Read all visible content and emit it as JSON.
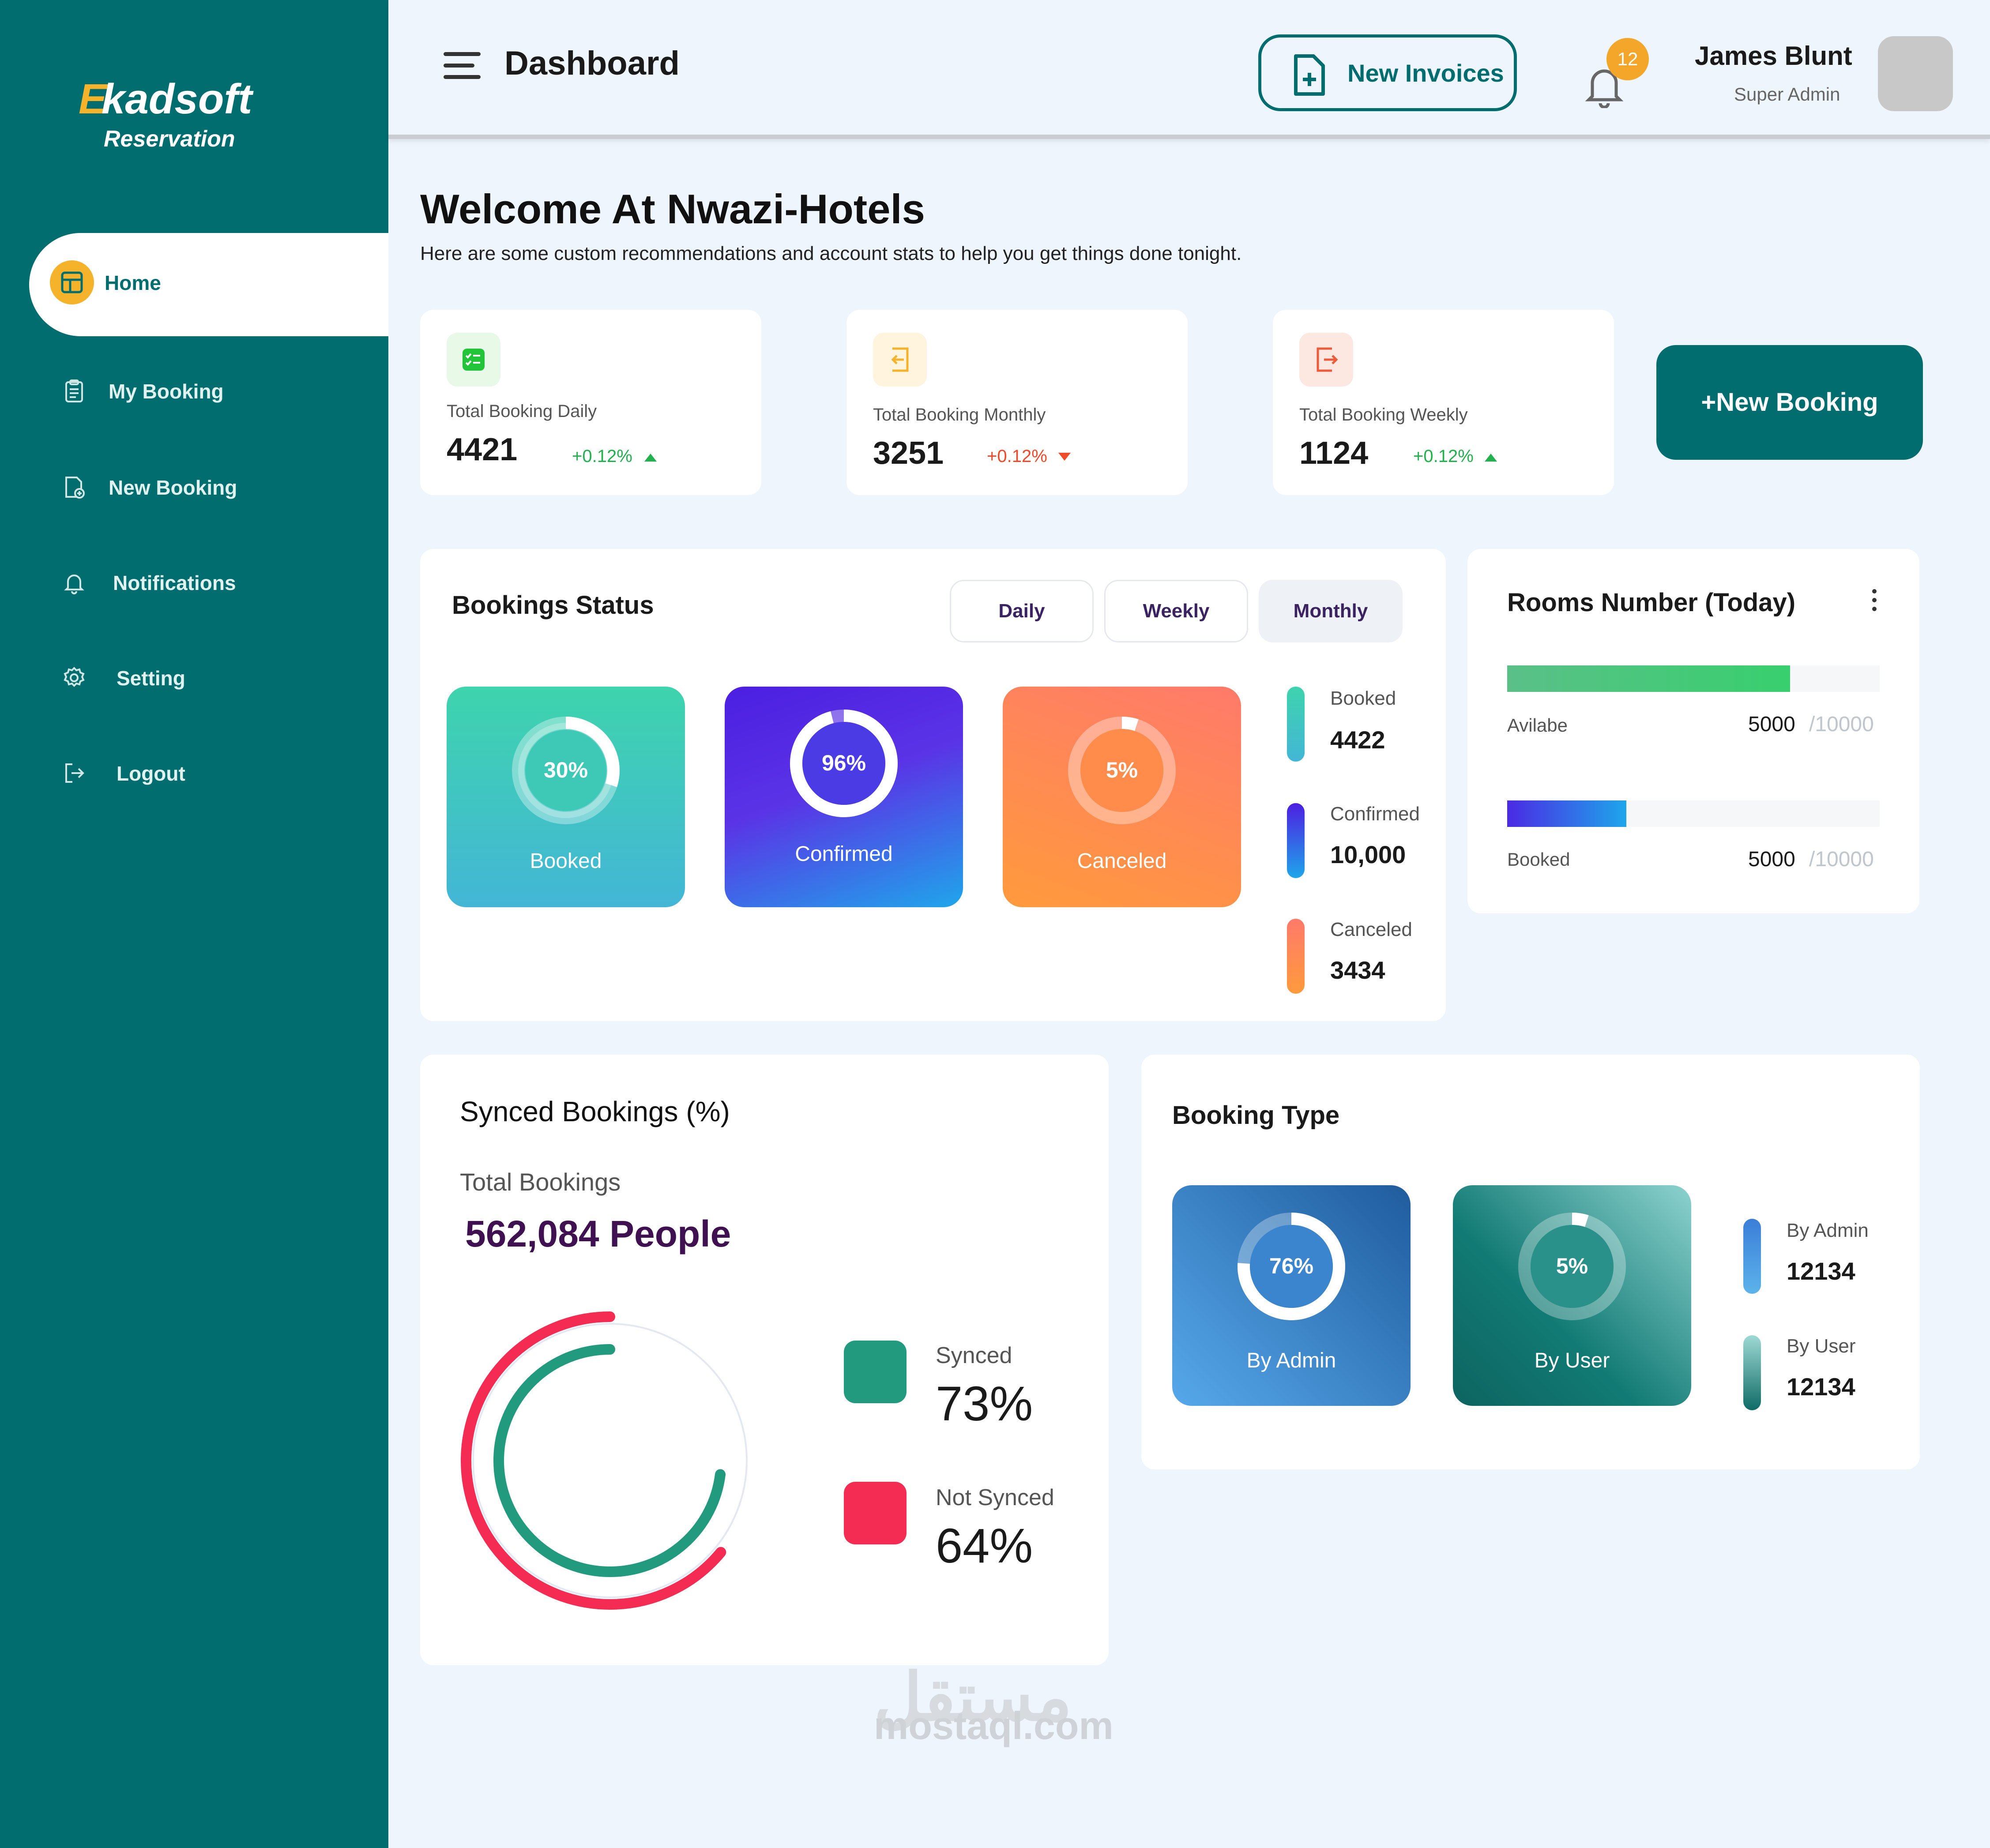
{
  "brand": {
    "initial": "E",
    "name": "kadsoft",
    "subtitle": "Reservation"
  },
  "sidebar": {
    "items": [
      {
        "label": "Home",
        "icon": "dashboard-icon",
        "active": true
      },
      {
        "label": "My Booking",
        "icon": "clipboard-icon"
      },
      {
        "label": "New Booking",
        "icon": "add-document-icon"
      },
      {
        "label": "Notifications",
        "icon": "bell-icon"
      },
      {
        "label": "Setting",
        "icon": "gear-icon"
      },
      {
        "label": "Logout",
        "icon": "logout-icon"
      }
    ]
  },
  "header": {
    "title": "Dashboard",
    "invoice_button": "New Invoices",
    "notification_count": "12",
    "user_name": "James Blunt",
    "user_role": "Super Admin"
  },
  "welcome": {
    "title": "Welcome At Nwazi-Hotels",
    "subtitle": "Here are some custom recommendations and account stats to help you get things done tonight."
  },
  "stats": [
    {
      "label": "Total Booking Daily",
      "value": "4421",
      "change": "+0.12%",
      "trend": "up"
    },
    {
      "label": "Total Booking Monthly",
      "value": "3251",
      "change": "+0.12%",
      "trend": "down"
    },
    {
      "label": "Total Booking Weekly",
      "value": "1124",
      "change": "+0.12%",
      "trend": "up"
    }
  ],
  "new_booking_button": "+New Booking",
  "bookings_status": {
    "title": "Bookings Status",
    "tabs": [
      "Daily",
      "Weekly",
      "Monthly"
    ],
    "selected_tab": "Monthly",
    "tiles": [
      {
        "label": "Booked",
        "percent": "30%",
        "fraction": 0.3
      },
      {
        "label": "Confirmed",
        "percent": "96%",
        "fraction": 0.96
      },
      {
        "label": "Canceled",
        "percent": "5%",
        "fraction": 0.05
      }
    ],
    "legend": [
      {
        "label": "Booked",
        "value": "4422"
      },
      {
        "label": "Confirmed",
        "value": "10,000"
      },
      {
        "label": "Canceled",
        "value": "3434"
      }
    ]
  },
  "rooms": {
    "title": "Rooms Number (Today)",
    "rows": [
      {
        "label": "Avilabe",
        "value": "5000",
        "max": "/10000",
        "fraction": 0.76
      },
      {
        "label": "Booked",
        "value": "5000",
        "max": "/10000",
        "fraction": 0.32
      }
    ]
  },
  "synced": {
    "title": "Synced Bookings (%)",
    "total_label": "Total Bookings",
    "total_value": "562,084 People",
    "items": [
      {
        "label": "Synced",
        "value": "73%",
        "fraction": 0.73,
        "color": "#229a7e"
      },
      {
        "label": "Not Synced",
        "value": "64%",
        "fraction": 0.64,
        "color": "#f42b52"
      }
    ]
  },
  "booking_type": {
    "title": "Booking Type",
    "tiles": [
      {
        "label": "By Admin",
        "percent": "76%",
        "fraction": 0.76
      },
      {
        "label": "By User",
        "percent": "5%",
        "fraction": 0.05
      }
    ],
    "legend": [
      {
        "label": "By Admin",
        "value": "12134"
      },
      {
        "label": "By User",
        "value": "12134"
      }
    ]
  },
  "watermark": {
    "arabic": "مستقل",
    "latin": "mostaql.com"
  },
  "colors": {
    "primary": "#016d6e",
    "accent": "#f4b32a",
    "up": "#22b14c",
    "down": "#ef4a2a"
  }
}
